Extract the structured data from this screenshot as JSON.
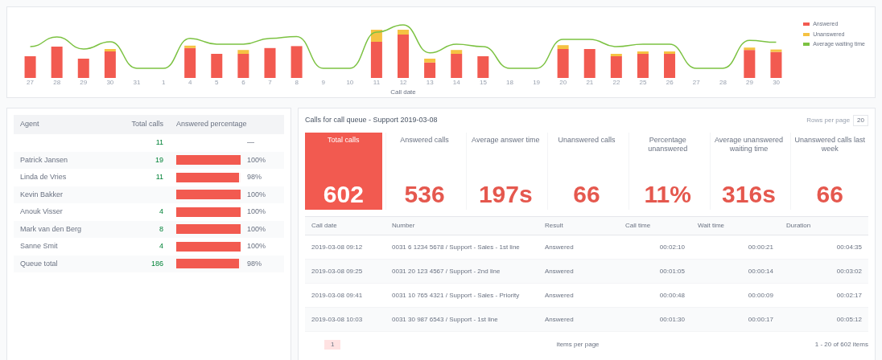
{
  "chart": {
    "legend": [
      {
        "label": "Answered",
        "color": "#f25a50"
      },
      {
        "label": "Unanswered",
        "color": "#f5c242"
      },
      {
        "label": "Average waiting time",
        "color": "#7cc242"
      }
    ],
    "x_labels": [
      "27",
      "28",
      "29",
      "30",
      "31",
      "1",
      "4",
      "5",
      "6",
      "7",
      "8",
      "9",
      "10",
      "11",
      "12",
      "13",
      "14",
      "15",
      "18",
      "19",
      "20",
      "21",
      "22",
      "25",
      "26",
      "27",
      "28",
      "29",
      "30"
    ],
    "xlabel": "Call date"
  },
  "agents": {
    "columns": [
      "Agent",
      "Total calls",
      "Answered percentage"
    ],
    "rows": [
      {
        "name": "",
        "calls": "11",
        "reading": "—"
      },
      {
        "name": "Patrick Jansen",
        "calls": "19",
        "level": 1,
        "reading": "100%"
      },
      {
        "name": "Linda de Vries",
        "calls": "11",
        "level": 0.98,
        "reading": "98%"
      },
      {
        "name": "Kevin Bakker",
        "calls": "",
        "level": 1,
        "reading": "100%"
      },
      {
        "name": "Anouk Visser",
        "calls": "4",
        "level": 1,
        "reading": "100%"
      },
      {
        "name": "Mark van den Berg",
        "calls": "8",
        "level": 1,
        "reading": "100%"
      },
      {
        "name": "Sanne Smit",
        "calls": "4",
        "level": 1,
        "reading": "100%"
      },
      {
        "name": "Queue total",
        "calls": "186",
        "level": 0.98,
        "reading": "98%"
      }
    ]
  },
  "calls": {
    "title": "Calls for call queue - Support 2019-03-08",
    "rows_label": "Rows per page",
    "rows_value": "20",
    "kpis": [
      {
        "label": "Total calls",
        "value": "602",
        "selected": true
      },
      {
        "label": "Answered calls",
        "value": "536",
        "selected": false
      },
      {
        "label": "Average answer time",
        "value": "197s",
        "selected": false
      },
      {
        "label": "Unanswered calls",
        "value": "66",
        "selected": false
      },
      {
        "label": "Percentage unanswered",
        "value": "11%",
        "selected": false
      },
      {
        "label": "Average unanswered waiting time",
        "value": "316s",
        "selected": false
      },
      {
        "label": "Unanswered calls last week",
        "value": "66",
        "selected": false
      }
    ],
    "columns": [
      "Call date",
      "Number",
      "Result",
      "Call time",
      "Wait time",
      "Duration"
    ],
    "rows": [
      [
        "2019-03-08 09:12",
        "0031 6 1234 5678 / Support - Sales - 1st line",
        "Answered",
        "00:02:10",
        "00:00:21",
        "00:04:35"
      ],
      [
        "2019-03-08 09:25",
        "0031 20 123 4567 / Support - 2nd line",
        "Answered",
        "00:01:05",
        "00:00:14",
        "00:03:02"
      ],
      [
        "2019-03-08 09:41",
        "0031 10 765 4321 / Support - Sales - Priority",
        "Answered",
        "00:00:48",
        "00:00:09",
        "00:02:17"
      ],
      [
        "2019-03-08 10:03",
        "0031 30 987 6543 / Support - 1st line",
        "Answered",
        "00:01:30",
        "00:00:17",
        "00:05:12"
      ]
    ],
    "pager": {
      "page": "1",
      "summary": "1 - 20 of 602 items",
      "page_size_label": "items per page"
    }
  }
}
